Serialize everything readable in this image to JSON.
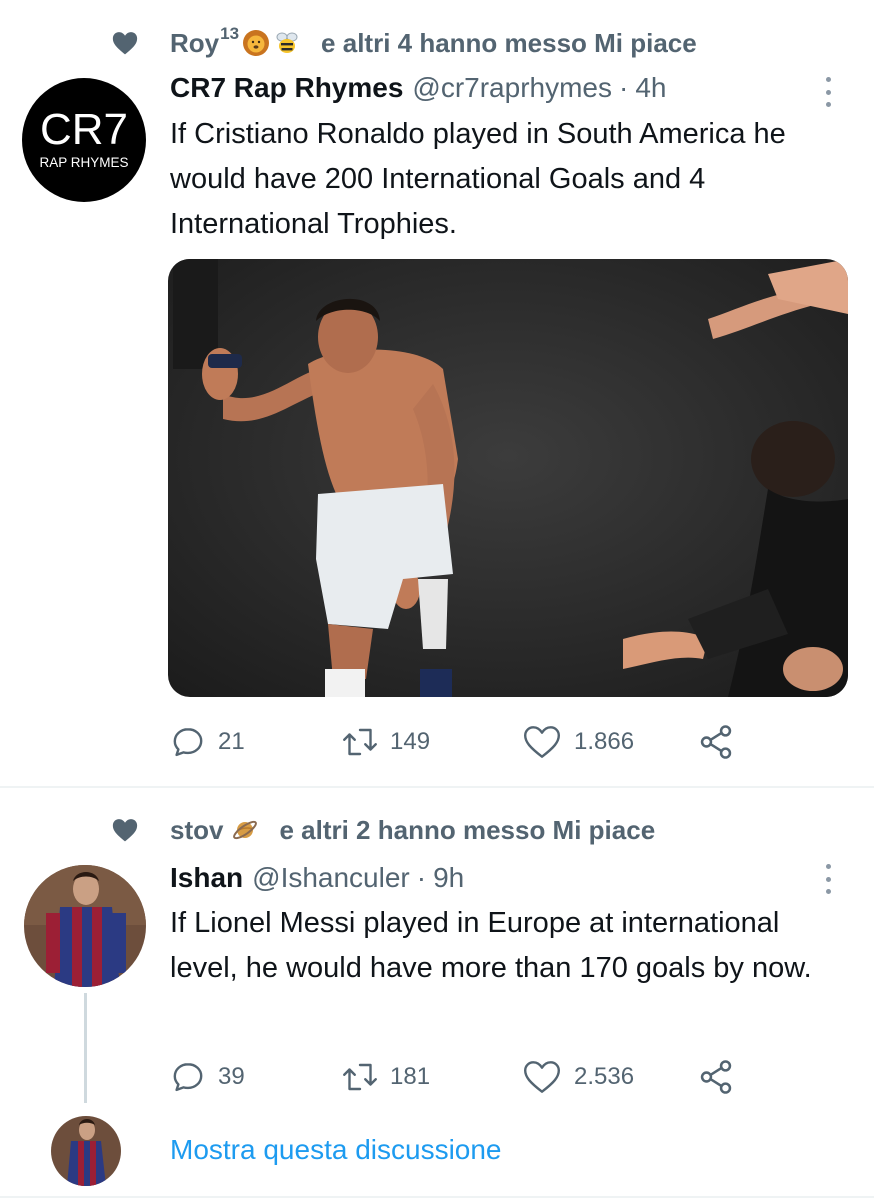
{
  "tweets": [
    {
      "social_context": {
        "text": "Roy",
        "sup": "13",
        "suffix": "e altri 4 hanno messo Mi piace"
      },
      "author": {
        "name": "CR7 Rap Rhymes",
        "handle": "@cr7raprhymes",
        "time": "4h",
        "avatar": {
          "line1": "CR7",
          "line2": "RAP RHYMES"
        }
      },
      "text": "If Cristiano Ronaldo played in South America he would have 200 International Goals and 4 International Trophies.",
      "stats": {
        "replies": "21",
        "retweets": "149",
        "likes": "1.866"
      }
    },
    {
      "social_context": {
        "text": "stov",
        "suffix": "e altri 2 hanno messo Mi piace"
      },
      "author": {
        "name": "Ishan",
        "handle": "@Ishanculer",
        "time": "9h"
      },
      "text": "If Lionel Messi played in Europe at international level, he would have more than 170 goals by now.",
      "stats": {
        "replies": "39",
        "retweets": "181",
        "likes": "2.536"
      }
    }
  ],
  "show_thread": "Mostra questa discussione",
  "icons": {
    "heart": "heart-icon",
    "reply": "reply-icon",
    "retweet": "retweet-icon",
    "like": "like-icon",
    "share": "share-icon",
    "more": "more-icon"
  },
  "colors": {
    "accent": "#1d9bf0",
    "secondary_text": "#536471",
    "primary_text": "#0f1419"
  }
}
